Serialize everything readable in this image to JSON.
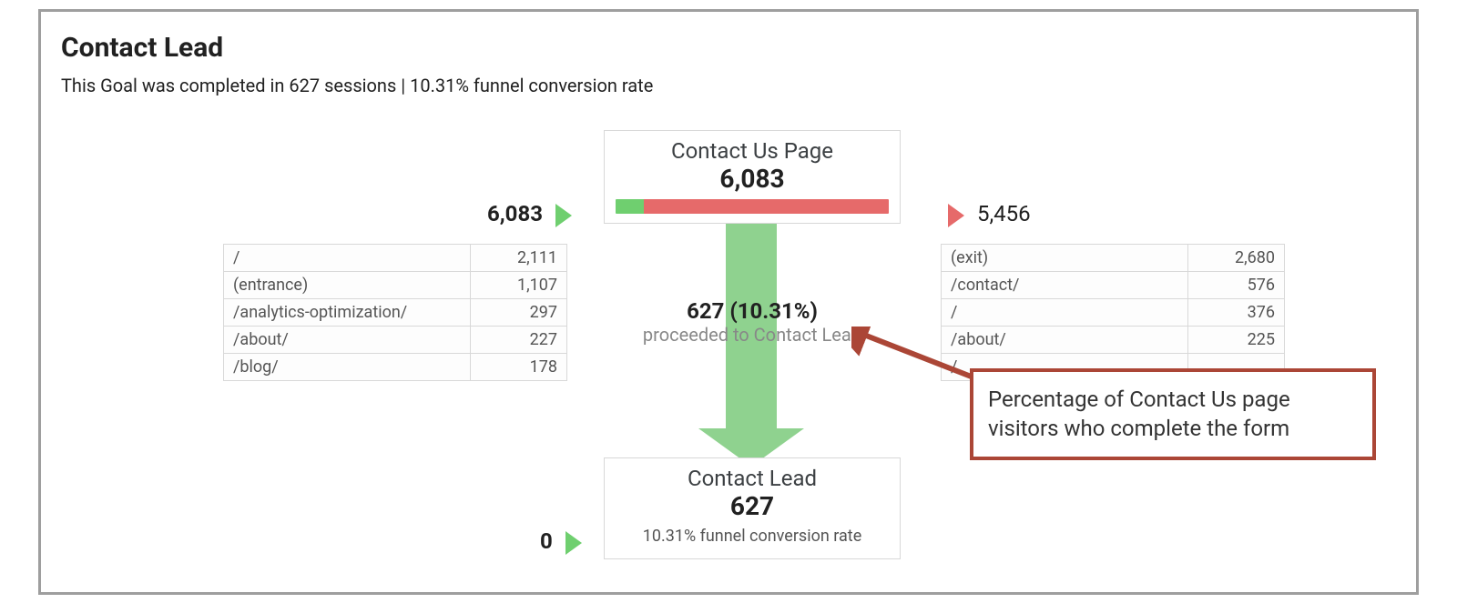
{
  "header": {
    "title": "Contact Lead",
    "subtitle": "This Goal was completed in 627 sessions | 10.31% funnel conversion rate"
  },
  "funnel": {
    "step1": {
      "name": "Contact Us Page",
      "count": "6,083",
      "entries_count": "6,083",
      "exits_count": "5,456",
      "bar_green_pct": 10.31,
      "bar_red_pct": 89.69,
      "proceed_label": "627 (10.31%)",
      "proceed_text": "proceeded to Contact Lead",
      "sources": [
        {
          "path": "/",
          "value": "2,111"
        },
        {
          "path": "(entrance)",
          "value": "1,107"
        },
        {
          "path": "/analytics-optimization/",
          "value": "297"
        },
        {
          "path": "/about/",
          "value": "227"
        },
        {
          "path": "/blog/",
          "value": "178"
        }
      ],
      "exits": [
        {
          "path": "(exit)",
          "value": "2,680"
        },
        {
          "path": "/contact/",
          "value": "576"
        },
        {
          "path": "/",
          "value": "376"
        },
        {
          "path": "/about/",
          "value": "225"
        },
        {
          "path": "/",
          "value": ""
        }
      ]
    },
    "step2": {
      "name": "Contact Lead",
      "count": "627",
      "conversion_note": "10.31% funnel conversion rate",
      "entries_count": "0"
    }
  },
  "annotation": {
    "text": "Percentage of Contact Us page visitors who complete the form"
  },
  "colors": {
    "green": "#6fcf6f",
    "red": "#e66a6a",
    "callout_border": "#ab4636"
  }
}
